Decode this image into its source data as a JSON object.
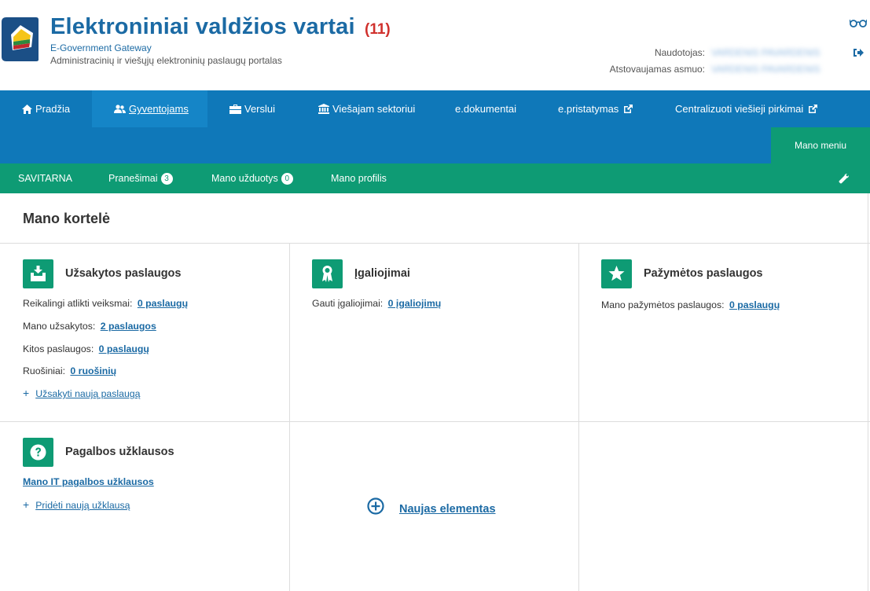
{
  "header": {
    "title": "Elektroniniai valdžios vartai",
    "count": "(11)",
    "subtitle": "E-Government Gateway",
    "tagline": "Administracinių ir viešųjų elektroninių paslaugų portalas",
    "user_label": "Naudotojas:",
    "user_value": "VARDENIS PAVARDENIS",
    "represented_label": "Atstovaujamas asmuo:",
    "represented_value": "VARDENIS PAVARDENIS"
  },
  "topnav": {
    "items": [
      {
        "label": "Pradžia",
        "icon": "home-icon"
      },
      {
        "label": "Gyventojams",
        "icon": "users-icon",
        "active": true
      },
      {
        "label": "Verslui",
        "icon": "briefcase-icon"
      },
      {
        "label": "Viešajam sektoriui",
        "icon": "institution-icon"
      },
      {
        "label": "e.dokumentai"
      },
      {
        "label": "e.pristatymas",
        "icon_after": "external-link-icon"
      },
      {
        "label": "Centralizuoti viešieji pirkimai",
        "icon_after": "external-link-icon"
      }
    ],
    "my_menu": "Mano meniu"
  },
  "subnav": {
    "self_service": "SAVITARNA",
    "messages": "Pranešimai",
    "messages_count": "3",
    "tasks": "Mano užduotys",
    "tasks_count": "0",
    "profile": "Mano profilis"
  },
  "main": {
    "title": "Mano kortelė",
    "cards": {
      "ordered": {
        "title": "Užsakytos paslaugos",
        "rows": [
          {
            "label": "Reikalingi atlikti veiksmai:",
            "value": "0 paslaugų"
          },
          {
            "label": "Mano užsakytos:",
            "value": "2 paslaugos"
          },
          {
            "label": "Kitos paslaugos:",
            "value": "0 paslaugų"
          },
          {
            "label": "Ruošiniai:",
            "value": "0 ruošinių"
          }
        ],
        "add": "Užsakyti naują paslaugą"
      },
      "authorizations": {
        "title": "Įgaliojimai",
        "rows": [
          {
            "label": "Gauti įgaliojimai:",
            "value": "0 įgaliojimų"
          }
        ]
      },
      "marked": {
        "title": "Pažymėtos paslaugos",
        "rows": [
          {
            "label": "Mano pažymėtos paslaugos:",
            "value": "0 paslaugų"
          }
        ]
      },
      "help": {
        "title": "Pagalbos užklausos",
        "link": "Mano IT pagalbos užklausos",
        "add": "Pridėti naują užklausą"
      },
      "new_element": "Naujas elementas"
    }
  },
  "colors": {
    "nav_blue": "#0f78b9",
    "green": "#0e9b74",
    "link_blue": "#1b6aa4",
    "count_red": "#d0312d"
  }
}
